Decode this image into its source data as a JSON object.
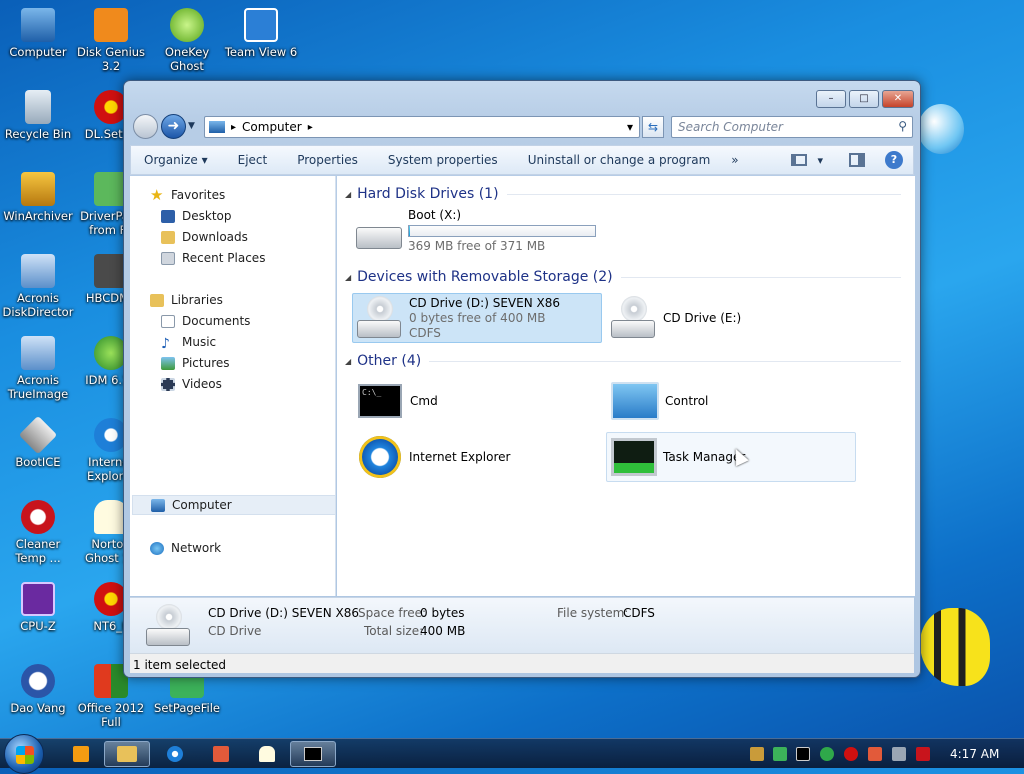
{
  "desktop": {
    "icons": [
      {
        "label": "Computer"
      },
      {
        "label": "Disk Genius 3.2"
      },
      {
        "label": "OneKey Ghost"
      },
      {
        "label": "Team View 6"
      },
      {
        "label": "Recycle Bin"
      },
      {
        "label": "DL.Setup"
      },
      {
        "label": "WinArchiver"
      },
      {
        "label": "DriverPack from Fo"
      },
      {
        "label": "Acronis DiskDirector"
      },
      {
        "label": "HBCDMe"
      },
      {
        "label": "Acronis TrueImage"
      },
      {
        "label": "IDM 6.12"
      },
      {
        "label": "BootICE"
      },
      {
        "label": "Internet Explorer"
      },
      {
        "label": "Cleaner Temp ..."
      },
      {
        "label": "Norton Ghost 11"
      },
      {
        "label": "CPU-Z"
      },
      {
        "label": "NT6_F"
      },
      {
        "label": "Dao Vang"
      },
      {
        "label": "Office 2012 Full"
      },
      {
        "label": "SetPageFile"
      }
    ]
  },
  "window": {
    "caption": {
      "minimize": "–",
      "maximize": "□",
      "close": "✕"
    },
    "address": {
      "location": "Computer",
      "sep": "▸",
      "dropdown": "▾"
    },
    "search": {
      "placeholder": "Search Computer"
    },
    "toolbar": {
      "items": [
        "Organize ▾",
        "Eject",
        "Properties",
        "System properties",
        "Uninstall or change a program",
        "»"
      ],
      "view": "▾"
    },
    "nav": {
      "favorites": "Favorites",
      "desktop": "Desktop",
      "downloads": "Downloads",
      "recent": "Recent Places",
      "libraries": "Libraries",
      "documents": "Documents",
      "music": "Music",
      "pictures": "Pictures",
      "videos": "Videos",
      "computer": "Computer",
      "network": "Network"
    },
    "groups": {
      "hdd": {
        "title": "Hard Disk Drives (1)",
        "items": [
          {
            "name": "Boot (X:)",
            "free": "369 MB free of 371 MB",
            "used_fraction": 0.005
          }
        ]
      },
      "removable": {
        "title": "Devices with Removable Storage (2)",
        "items": [
          {
            "name": "CD Drive (D:) SEVEN X86",
            "free": "0 bytes free of 400 MB",
            "fs": "CDFS"
          },
          {
            "name": "CD Drive (E:)"
          }
        ]
      },
      "other": {
        "title": "Other (4)",
        "items": [
          {
            "name": "Cmd"
          },
          {
            "name": "Control"
          },
          {
            "name": "Internet Explorer"
          },
          {
            "name": "Task Manager"
          }
        ]
      }
    },
    "details": {
      "name": "CD Drive (D:) SEVEN X86",
      "type": "CD Drive",
      "space_free_label": "Space free:",
      "space_free": "0 bytes",
      "total_label": "Total size:",
      "total": "400 MB",
      "fs_label": "File system:",
      "fs": "CDFS"
    },
    "status": "1 item selected"
  },
  "taskbar": {
    "clock": "4:17 AM"
  },
  "colors": {
    "accent": "#1e3287",
    "selection": "#cce4f7"
  }
}
